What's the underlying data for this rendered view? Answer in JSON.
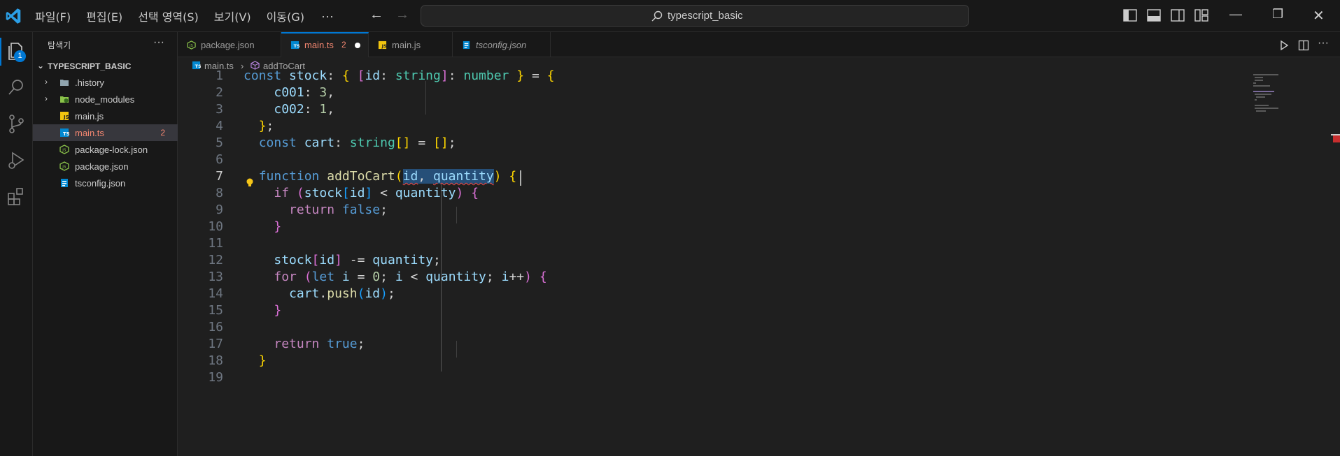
{
  "app": {
    "menu": [
      "파일(F)",
      "편집(E)",
      "선택 영역(S)",
      "보기(V)",
      "이동(G)"
    ],
    "menu_more": "···",
    "search_text": "typescript_basic"
  },
  "activity": {
    "explorer_badge": "1",
    "accent": "#0078d4"
  },
  "sidebar": {
    "title": "탐색기",
    "more": "···",
    "folder": "TYPESCRIPT_BASIC",
    "items": [
      {
        "name": ".history",
        "kind": "folder",
        "icon": "folder-icon"
      },
      {
        "name": "node_modules",
        "kind": "folder",
        "icon": "node-folder-icon"
      },
      {
        "name": "main.js",
        "kind": "file",
        "icon": "js-file-icon"
      },
      {
        "name": "main.ts",
        "kind": "file",
        "icon": "ts-file-icon",
        "active": true,
        "errors": "2"
      },
      {
        "name": "package-lock.json",
        "kind": "file",
        "icon": "npm-file-icon"
      },
      {
        "name": "package.json",
        "kind": "file",
        "icon": "npm-file-icon"
      },
      {
        "name": "tsconfig.json",
        "kind": "file",
        "icon": "tsconfig-file-icon"
      }
    ]
  },
  "tabs": [
    {
      "label": "package.json",
      "icon": "npm-file-icon"
    },
    {
      "label": "main.ts",
      "icon": "ts-file-icon",
      "active": true,
      "errors": "2",
      "modified": true
    },
    {
      "label": "main.js",
      "icon": "js-file-icon"
    },
    {
      "label": "tsconfig.json",
      "icon": "tsconfig-file-icon",
      "preview": true
    }
  ],
  "breadcrumb": {
    "file": "main.ts",
    "symbol": "addToCart"
  },
  "editor": {
    "current_line": 7,
    "line_numbers": [
      "1",
      "2",
      "3",
      "4",
      "5",
      "6",
      "7",
      "8",
      "9",
      "10",
      "11",
      "12",
      "13",
      "14",
      "15",
      "16",
      "17",
      "18",
      "19"
    ],
    "code_lines": [
      "const stock: { [id: string]: number } = {",
      "    c001: 3,",
      "    c002: 1,",
      "  };",
      "  const cart: string[] = [];",
      "",
      "  function addToCart(id, quantity) {",
      "    if (stock[id] < quantity) {",
      "      return false;",
      "    }",
      "",
      "    stock[id] -= quantity;",
      "    for (let i = 0; i < quantity; i++) {",
      "      cart.push(id);",
      "    }",
      "",
      "    return true;",
      "  }",
      ""
    ]
  }
}
